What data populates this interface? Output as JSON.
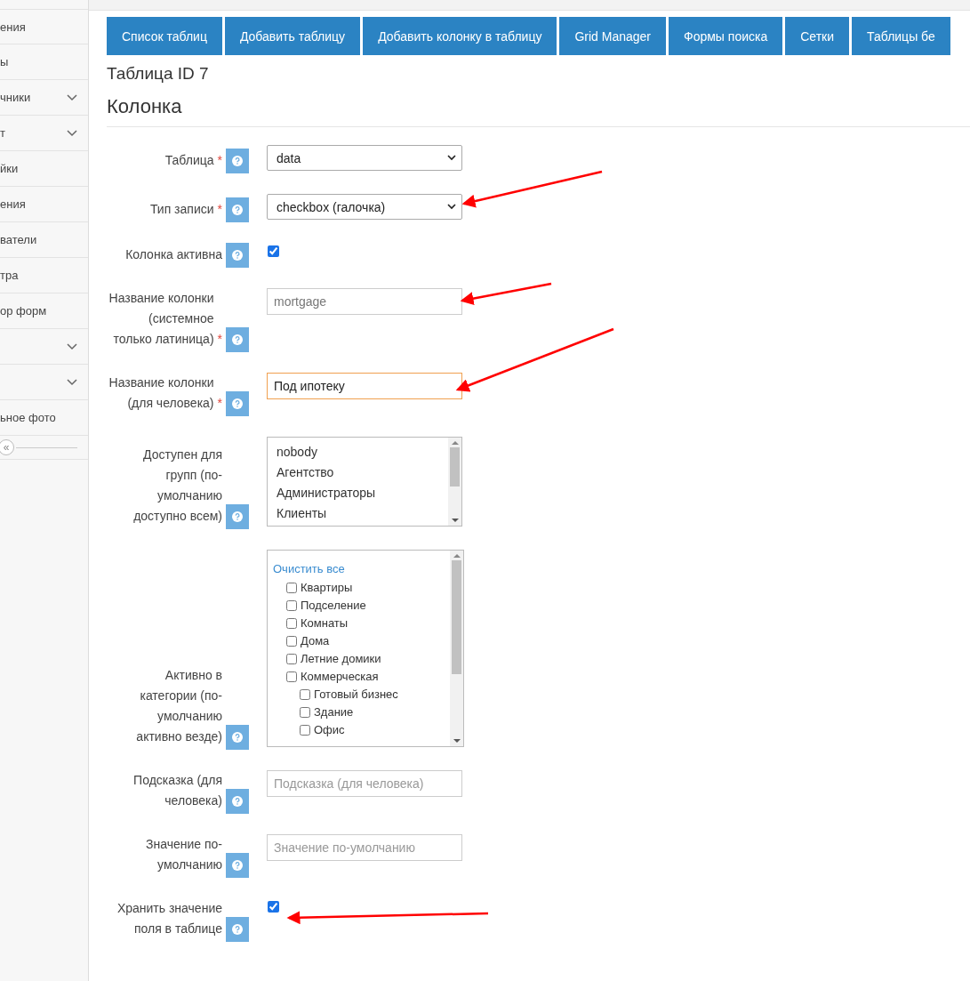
{
  "sidebar": {
    "items": [
      {
        "label": "ения",
        "expandable": false
      },
      {
        "label": "ы",
        "expandable": false
      },
      {
        "label": "чники",
        "expandable": true
      },
      {
        "label": "т",
        "expandable": true
      },
      {
        "label": "йки",
        "expandable": false
      },
      {
        "label": "ения",
        "expandable": false
      },
      {
        "label": "ватели",
        "expandable": false
      },
      {
        "label": "тра",
        "expandable": false
      },
      {
        "label": "ор форм",
        "expandable": false
      },
      {
        "expandable": true
      },
      {
        "expandable": true
      },
      {
        "label": "ьное фото",
        "expandable": false
      }
    ],
    "collapse_label": "«"
  },
  "nav_tabs": [
    "Список таблиц",
    "Добавить таблицу",
    "Добавить колонку в таблицу",
    "Grid Manager",
    "Формы поиска",
    "Сетки",
    "Таблицы бе"
  ],
  "page_title": "Таблица ID 7",
  "section_title": "Колонка",
  "required_mark": "*",
  "fields": [
    {
      "kind": "select",
      "label": "Таблица",
      "required": true,
      "value": "data"
    },
    {
      "kind": "select",
      "label": "Тип записи",
      "required": true,
      "value": "checkbox (галочка)"
    },
    {
      "kind": "checkbox",
      "label": "Колонка активна",
      "checked": true
    },
    {
      "kind": "text",
      "label": "Название колонки (системное только латиница)",
      "required": true,
      "value": "mortgage",
      "readonly": true
    },
    {
      "kind": "text",
      "label": "Название колонки (для человека)",
      "required": true,
      "value": "Под ипотеку",
      "focused": true
    },
    {
      "kind": "multiselect",
      "label": "Доступен для групп (по-умолчанию доступно всем)",
      "options": [
        "nobody",
        "Агентство",
        "Администраторы",
        "Клиенты"
      ]
    },
    {
      "kind": "tree",
      "label": "Активно в категории (по-умолчанию активно везде)",
      "clear_link": "Очистить все",
      "items": [
        {
          "label": "Квартиры",
          "checked": false
        },
        {
          "label": "Подселение",
          "checked": false
        },
        {
          "label": "Комнаты",
          "checked": false
        },
        {
          "label": "Дома",
          "checked": false
        },
        {
          "label": "Летние домики",
          "checked": false
        },
        {
          "label": "Коммерческая",
          "checked": false,
          "children": [
            {
              "label": "Готовый бизнес",
              "checked": false
            },
            {
              "label": "Здание",
              "checked": false
            },
            {
              "label": "Офис",
              "checked": false
            }
          ]
        }
      ]
    },
    {
      "kind": "text",
      "label": "Подсказка (для человека)",
      "placeholder": "Подсказка (для человека)"
    },
    {
      "kind": "text",
      "label": "Значение по-умолчанию",
      "placeholder": "Значение по-умолчанию"
    },
    {
      "kind": "checkbox",
      "label": "Хранить значение поля в таблице",
      "checked": true
    }
  ]
}
